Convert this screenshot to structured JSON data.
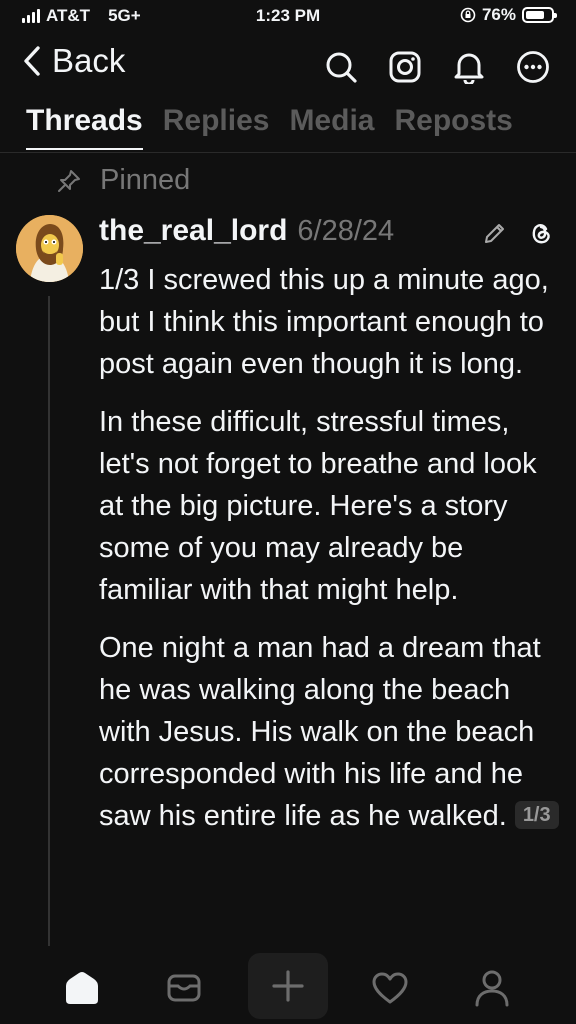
{
  "status_bar": {
    "carrier": "AT&T",
    "network": "5G+",
    "time": "1:23 PM",
    "battery": "76%",
    "battery_level": 0.76
  },
  "nav": {
    "back_label": "Back",
    "icons": [
      "search-icon",
      "instagram-icon",
      "bell-icon",
      "more-icon"
    ]
  },
  "tabs": [
    {
      "label": "Threads",
      "active": true
    },
    {
      "label": "Replies",
      "active": false
    },
    {
      "label": "Media",
      "active": false
    },
    {
      "label": "Reposts",
      "active": false
    }
  ],
  "pinned": {
    "label": "Pinned"
  },
  "post": {
    "username": "the_real_lord",
    "date": "6/28/24",
    "paragraphs": [
      "1/3 I screwed this up a minute ago, but I think this important enough to post again even though it is long.",
      "In these difficult, stressful times, let's not forget to breathe and look at the big picture. Here's a story some of you may already be familiar with that might help.",
      "One night a man had a dream that he was walking along the beach with Jesus. His walk on the beach corresponded with his life and he saw his entire life as he walked."
    ],
    "page_indicator": "1/3"
  },
  "bottom_nav": [
    "home-icon",
    "inbox-icon",
    "create-icon",
    "heart-icon",
    "profile-icon"
  ],
  "colors": {
    "background": "#101010",
    "text": "#f3f5f7",
    "muted": "#777777",
    "inactive_tab": "#5b5b5b"
  }
}
